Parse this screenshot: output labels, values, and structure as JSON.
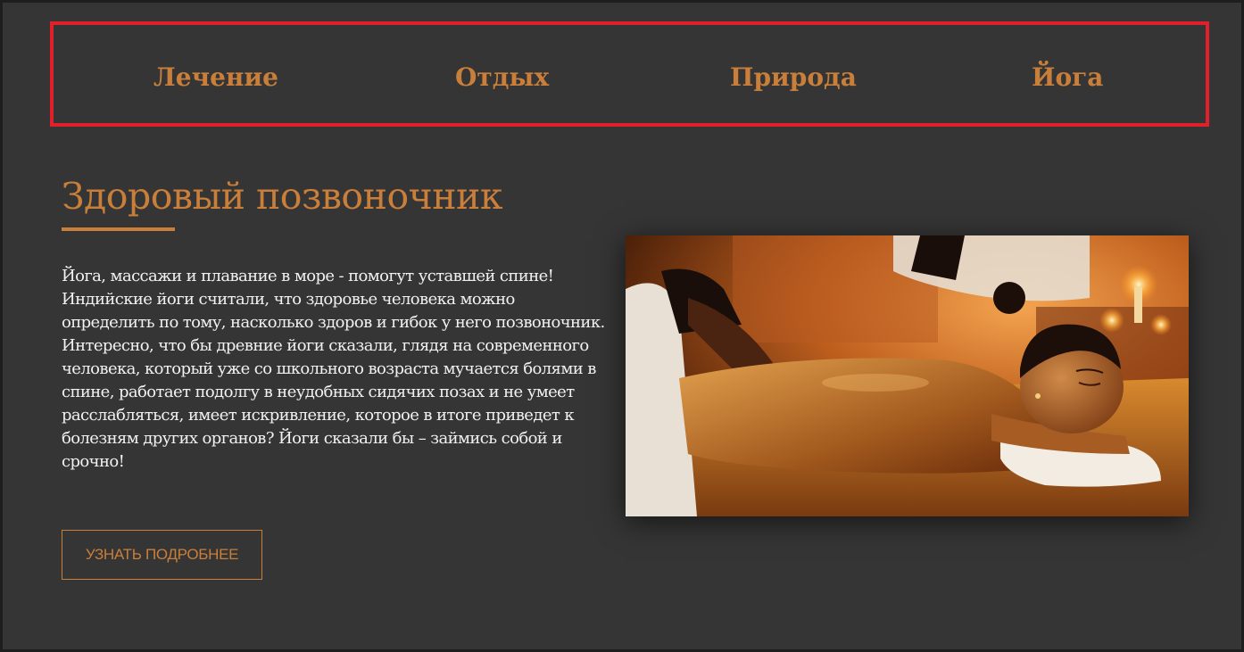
{
  "nav": {
    "items": [
      {
        "label": "Лечение"
      },
      {
        "label": "Отдых"
      },
      {
        "label": "Природа"
      },
      {
        "label": "Йога"
      }
    ]
  },
  "section": {
    "title": "Здоровый позвоночник",
    "paragraphs": [
      "Йога, массажи и плавание в море - помогут уставшей спине! Индийские йоги считали, что здоровье человека можно определить по тому, насколько здоров и гибок у него позвоночник.",
      "Интересно, что бы древние йоги сказали, глядя на современного человека, который уже со школьного возраста мучается болями в спине, работает подолгу в неудобных сидячих позах и не умеет расслабляться, имеет искривление, которое в итоге приведет к болезням других органов? Йоги сказали бы – займись собой и срочно!"
    ],
    "button_label": "УЗНАТЬ ПОДРОБНЕЕ"
  },
  "colors": {
    "accent": "#c97f3a",
    "background": "#353535",
    "highlight_border": "#e0212b",
    "text": "#f1f1f1"
  }
}
